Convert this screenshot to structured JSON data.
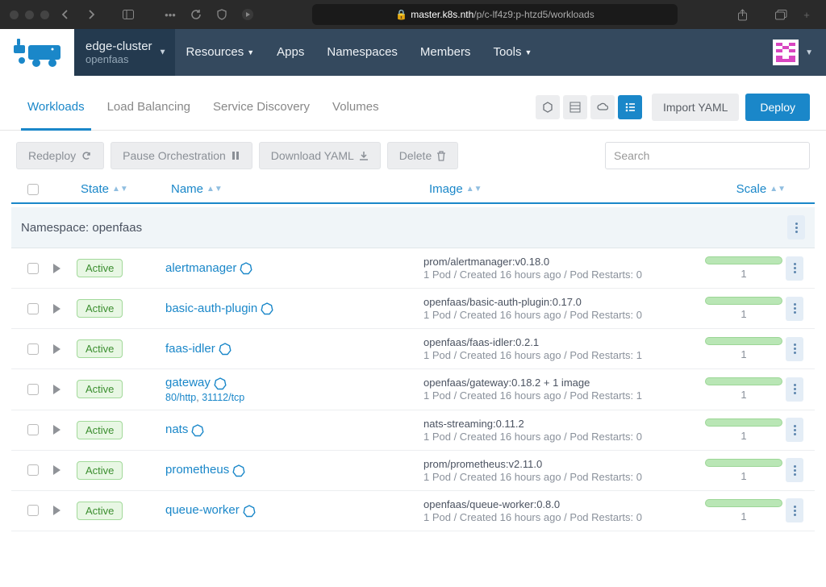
{
  "browser": {
    "url_domain": "master.k8s.nth",
    "url_path": "/p/c-lf4z9:p-htzd5/workloads"
  },
  "nav": {
    "cluster_name": "edge-cluster",
    "namespace_name": "openfaas",
    "items": {
      "resources": "Resources",
      "apps": "Apps",
      "namespaces": "Namespaces",
      "members": "Members",
      "tools": "Tools"
    }
  },
  "tabs": {
    "workloads": "Workloads",
    "load_balancing": "Load Balancing",
    "service_discovery": "Service Discovery",
    "volumes": "Volumes",
    "import_yaml": "Import YAML",
    "deploy": "Deploy"
  },
  "actions": {
    "redeploy": "Redeploy",
    "pause": "Pause Orchestration",
    "download": "Download YAML",
    "delete": "Delete",
    "search_placeholder": "Search"
  },
  "table": {
    "headers": {
      "state": "State",
      "name": "Name",
      "image": "Image",
      "scale": "Scale"
    },
    "group_label": "Namespace: openfaas",
    "rows": [
      {
        "state": "Active",
        "name": "alertmanager",
        "sub": "",
        "image": "prom/alertmanager:v0.18.0",
        "meta": "1 Pod / Created 16 hours ago / Pod Restarts: 0",
        "scale": "1"
      },
      {
        "state": "Active",
        "name": "basic-auth-plugin",
        "sub": "",
        "image": "openfaas/basic-auth-plugin:0.17.0",
        "meta": "1 Pod / Created 16 hours ago / Pod Restarts: 0",
        "scale": "1"
      },
      {
        "state": "Active",
        "name": "faas-idler",
        "sub": "",
        "image": "openfaas/faas-idler:0.2.1",
        "meta": "1 Pod / Created 16 hours ago / Pod Restarts: 1",
        "scale": "1"
      },
      {
        "state": "Active",
        "name": "gateway",
        "sub": "80/http, 31112/tcp",
        "image": "openfaas/gateway:0.18.2 + 1 image",
        "meta": "1 Pod / Created 16 hours ago / Pod Restarts: 1",
        "scale": "1"
      },
      {
        "state": "Active",
        "name": "nats",
        "sub": "",
        "image": "nats-streaming:0.11.2",
        "meta": "1 Pod / Created 16 hours ago / Pod Restarts: 0",
        "scale": "1"
      },
      {
        "state": "Active",
        "name": "prometheus",
        "sub": "",
        "image": "prom/prometheus:v2.11.0",
        "meta": "1 Pod / Created 16 hours ago / Pod Restarts: 0",
        "scale": "1"
      },
      {
        "state": "Active",
        "name": "queue-worker",
        "sub": "",
        "image": "openfaas/queue-worker:0.8.0",
        "meta": "1 Pod / Created 16 hours ago / Pod Restarts: 0",
        "scale": "1"
      }
    ]
  }
}
